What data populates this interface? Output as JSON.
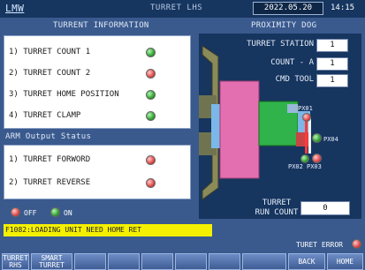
{
  "header": {
    "app_title": "LMW",
    "screen_title": "TURRET LHS",
    "date": "2022.05.20",
    "time": "14:15"
  },
  "turrent_info": {
    "title": "TURRENT INFORMATION",
    "items": [
      {
        "label": "1) TURRET COUNT 1",
        "status": "green"
      },
      {
        "label": "2) TURRET COUNT 2",
        "status": "red"
      },
      {
        "label": "3) TURRET HOME POSITION",
        "status": "green"
      },
      {
        "label": "4) TURRET CLAMP",
        "status": "green"
      }
    ]
  },
  "arm_output": {
    "title": "ARM Output Status",
    "items": [
      {
        "label": "1) TURRET FORWORD",
        "status": "red"
      },
      {
        "label": "2) TURRET REVERSE",
        "status": "red"
      }
    ]
  },
  "legend": {
    "off_label": "OFF",
    "on_label": "ON"
  },
  "alarm": {
    "message": "F1082:LOADING UNIT NEED HOME RET"
  },
  "proximity_dog": {
    "title": "PROXIMITY DOG",
    "turret_station_label": "TURRET STATION",
    "turret_station_value": "1",
    "count_a_label": "COUNT - A",
    "count_a_value": "1",
    "cmd_tool_label": "CMD TOOL",
    "cmd_tool_value": "1",
    "run_count_label_line1": "TURRET",
    "run_count_label_line2": "RUN COUNT",
    "run_count_value": "0",
    "sensors": [
      {
        "label": "PX01",
        "status": "off"
      },
      {
        "label": "PX04",
        "status": "on"
      },
      {
        "label": "PX02",
        "status": "on"
      },
      {
        "label": "PX03",
        "status": "off"
      }
    ]
  },
  "turet_error": {
    "label": "TURET ERROR",
    "status": "red"
  },
  "footer": {
    "buttons": [
      {
        "line1": "TURRET",
        "line2": "RHS"
      },
      {
        "line1": "SMART",
        "line2": "TURRET"
      }
    ],
    "back_label": "BACK",
    "home_label": "HOME"
  },
  "colors": {
    "background": "#3a5a8e",
    "panel_dark": "#16355f",
    "lamp_on": "#2fa32f",
    "lamp_off": "#e04848",
    "alarm_bg": "#f5f000",
    "turret_body": "#e46fb0",
    "turret_tool": "#2fb34a"
  }
}
